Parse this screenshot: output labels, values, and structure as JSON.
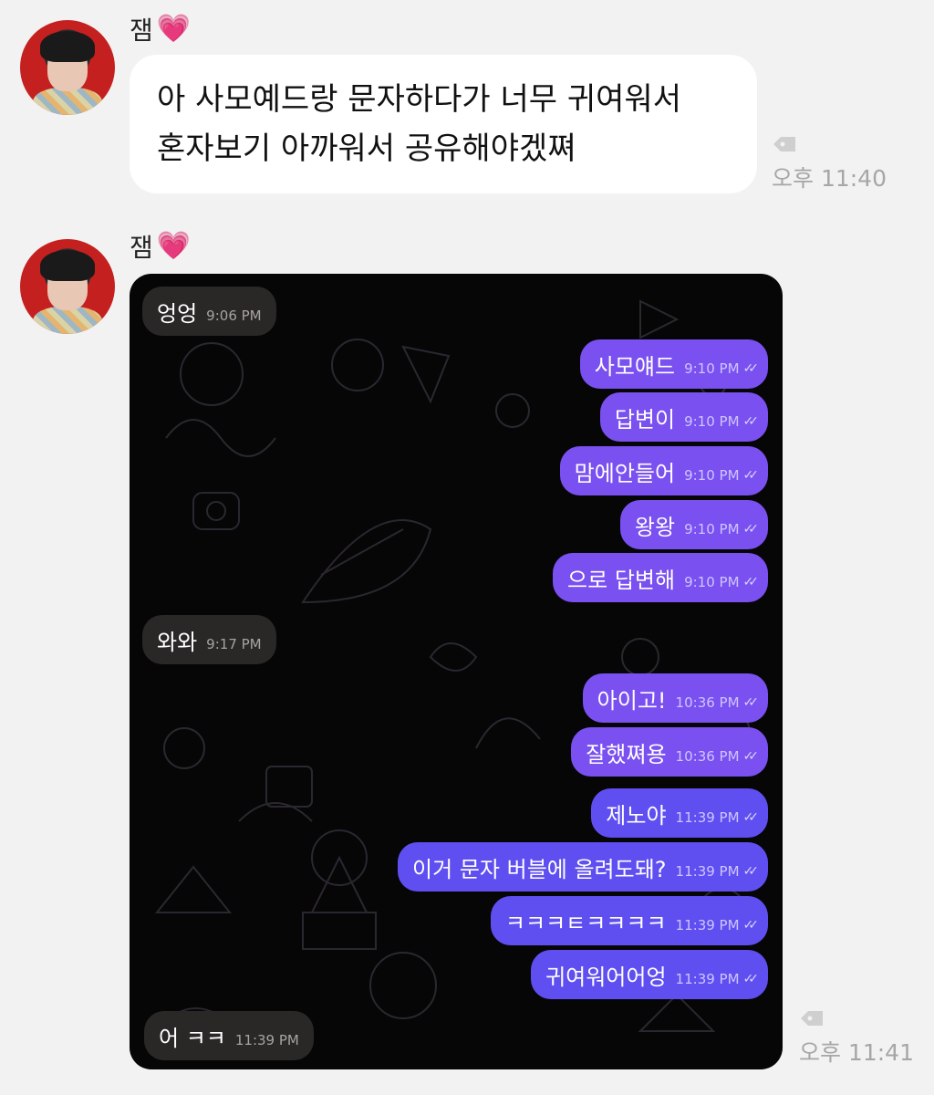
{
  "messages": [
    {
      "sender": "잼",
      "heart": "💗",
      "lines": [
        "아 사모예드랑 문자하다가 너무 귀여워서",
        "혼자보기 아까워서 공유해야겠쪄"
      ],
      "time": "오후 11:40"
    },
    {
      "sender": "잼",
      "heart": "💗",
      "time": "오후 11:41"
    }
  ],
  "screenshot": {
    "bubbles": [
      {
        "dir": "in",
        "text": "엉엉",
        "time": "9:06 PM"
      },
      {
        "dir": "out",
        "text": "사모얘드",
        "time": "9:10 PM"
      },
      {
        "dir": "out",
        "text": "답변이",
        "time": "9:10 PM"
      },
      {
        "dir": "out",
        "text": "맘에안들어",
        "time": "9:10 PM"
      },
      {
        "dir": "out",
        "text": "왕왕",
        "time": "9:10 PM"
      },
      {
        "dir": "out",
        "text": "으로 답변해",
        "time": "9:10 PM"
      },
      {
        "dir": "in",
        "text": "와와",
        "time": "9:17 PM"
      },
      {
        "dir": "out",
        "text": "아이고!",
        "time": "10:36 PM"
      },
      {
        "dir": "out",
        "text": "잘했쪄용",
        "time": "10:36 PM"
      },
      {
        "dir": "out",
        "text": "제노야",
        "time": "11:39 PM"
      },
      {
        "dir": "out",
        "text": "이거 문자 버블에 올려도돼?",
        "time": "11:39 PM"
      },
      {
        "dir": "out",
        "text": "ㅋㅋㅋㅌㅋㅋㅋㅋ",
        "time": "11:39 PM"
      },
      {
        "dir": "out",
        "text": "귀여워어어엉",
        "time": "11:39 PM"
      },
      {
        "dir": "in",
        "text": "어 ㅋㅋ",
        "time": "11:39 PM"
      }
    ]
  },
  "colors": {
    "background": "#f2f2f2",
    "bubble": "#ffffff",
    "outgoing": "#7a50f0",
    "incoming": "#2a2727",
    "heart": "#ff4fae"
  },
  "icons": [
    "avatar",
    "heart-icon",
    "tag-icon",
    "double-check-icon"
  ]
}
